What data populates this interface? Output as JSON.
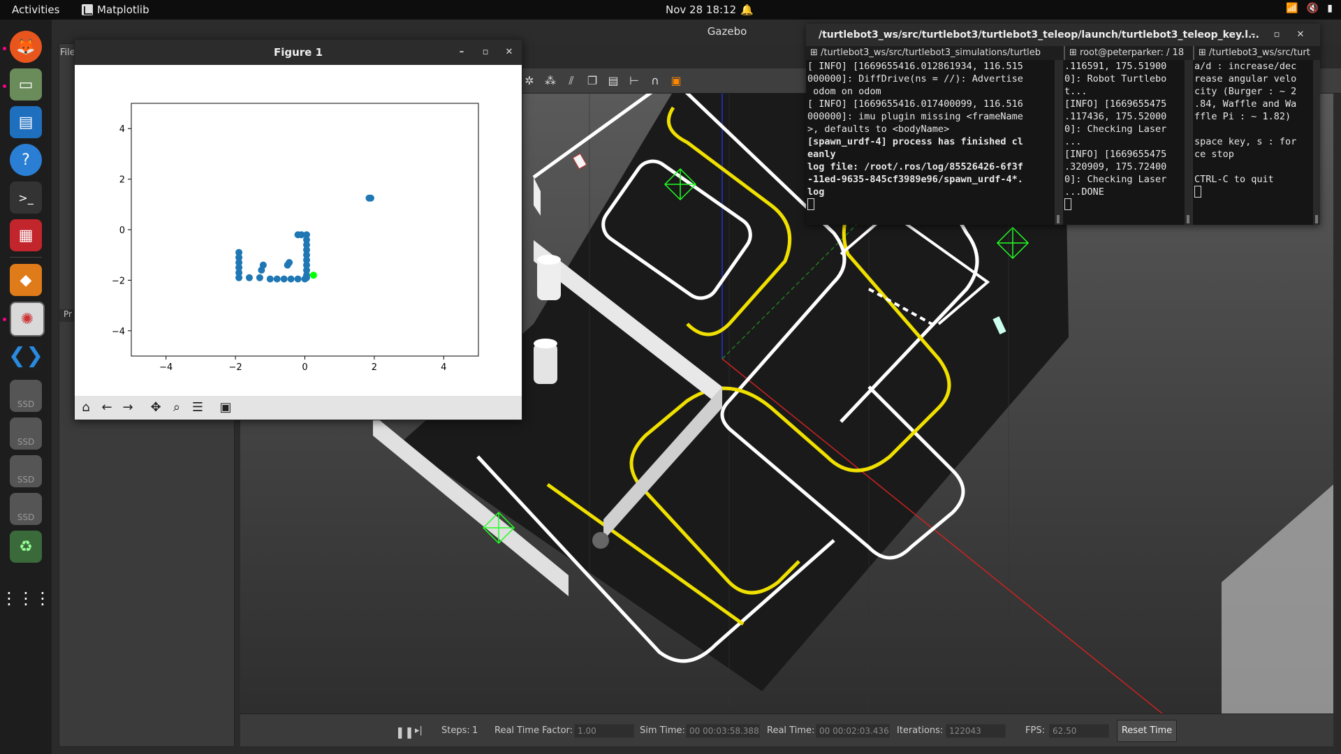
{
  "topbar": {
    "activities": "Activities",
    "app_name": "Matplotlib",
    "date_time": "Nov 28  18:12"
  },
  "dock": {
    "icons": [
      "firefox-icon",
      "files-icon",
      "writer-icon",
      "help-icon",
      "terminal-icon",
      "app-icon",
      "sublime-icon",
      "rqt-icon",
      "vscode-icon"
    ],
    "ssd_label": "SSD"
  },
  "gazebo": {
    "title": "Gazebo",
    "menu_file": "File",
    "left_panel_label": "Pr",
    "bottom": {
      "steps_label": "Steps:",
      "steps_value": "1",
      "rtf_label": "Real Time Factor:",
      "rtf_value": "1.00",
      "sim_time_label": "Sim Time:",
      "sim_time_value": "00 00:03:58.388",
      "real_time_label": "Real Time:",
      "real_time_value": "00 00:02:03.436",
      "iterations_label": "Iterations:",
      "iterations_value": "122043",
      "fps_label": "FPS:",
      "fps_value": "62.50",
      "reset_label": "Reset Time"
    }
  },
  "figure": {
    "title": "Figure 1",
    "toolbar": [
      "home-icon",
      "back-icon",
      "forward-icon",
      "pan-icon",
      "zoom-icon",
      "configure-icon",
      "save-icon"
    ]
  },
  "chart_data": {
    "type": "scatter",
    "title": "",
    "xlabel": "",
    "ylabel": "",
    "xlim": [
      -5,
      5
    ],
    "ylim": [
      -5,
      5
    ],
    "xticks": [
      -4,
      -2,
      0,
      2,
      4
    ],
    "yticks": [
      4,
      2,
      0,
      -2,
      -4
    ],
    "xtick_labels": [
      "−4",
      "−2",
      "0",
      "2",
      "4"
    ],
    "ytick_labels": [
      "4",
      "2",
      "0",
      "−2",
      "−4"
    ],
    "grid": false,
    "series": [
      {
        "color": "#1f77b4",
        "points": [
          [
            1.85,
            1.25
          ],
          [
            1.9,
            1.25
          ],
          [
            -1.9,
            -0.9
          ],
          [
            -1.9,
            -1.1
          ],
          [
            -1.9,
            -1.3
          ],
          [
            -1.9,
            -1.5
          ],
          [
            -1.9,
            -1.7
          ],
          [
            -1.9,
            -1.9
          ],
          [
            -1.6,
            -1.9
          ],
          [
            -1.3,
            -1.9
          ],
          [
            -1.25,
            -1.6
          ],
          [
            -1.2,
            -1.4
          ],
          [
            -1.0,
            -1.95
          ],
          [
            -0.8,
            -1.95
          ],
          [
            -0.6,
            -1.95
          ],
          [
            -0.4,
            -1.95
          ],
          [
            -0.2,
            -1.95
          ],
          [
            0.0,
            -1.95
          ],
          [
            -0.5,
            -1.4
          ],
          [
            -0.45,
            -1.3
          ],
          [
            -0.2,
            -0.2
          ],
          [
            -0.1,
            -0.2
          ],
          [
            0.05,
            -0.2
          ],
          [
            0.05,
            -0.4
          ],
          [
            0.05,
            -0.6
          ],
          [
            0.05,
            -0.8
          ],
          [
            0.05,
            -1.0
          ],
          [
            0.05,
            -1.2
          ],
          [
            0.05,
            -1.4
          ],
          [
            0.05,
            -1.6
          ],
          [
            0.05,
            -1.8
          ],
          [
            0.05,
            -1.9
          ]
        ]
      },
      {
        "color": "#00ff00",
        "points": [
          [
            0.25,
            -1.8
          ]
        ]
      }
    ]
  },
  "terminal": {
    "title": "/turtlebot3_ws/src/turtlebot3/turtlebot3_teleop/launch/turtlebot3_teleop_key.l...",
    "tabs": [
      "/turtlebot3_ws/src/turtlebot3_simulations/turtleb",
      "root@peterparker: / 18",
      "/turtlebot3_ws/src/turt"
    ],
    "pane1": [
      "[ INFO] [1669655416.012861934, 116.515",
      "000000]: DiffDrive(ns = //): Advertise",
      " odom on odom",
      "[ INFO] [1669655416.017400099, 116.516",
      "000000]: imu plugin missing <frameName",
      ">, defaults to <bodyName>",
      "[spawn_urdf-4] process has finished cl",
      "eanly",
      "log file: /root/.ros/log/85526426-6f3f",
      "-11ed-9635-845cf3989e96/spawn_urdf-4*.",
      "log"
    ],
    "pane2": [
      ".116591, 175.51900",
      "0]: Robot Turtlebo",
      "t...",
      "[INFO] [1669655475",
      ".117436, 175.52000",
      "0]: Checking Laser",
      "...",
      "[INFO] [1669655475",
      ".320909, 175.72400",
      "0]: Checking Laser",
      "...DONE"
    ],
    "pane3": [
      "a/d : increase/dec",
      "rease angular velo",
      "city (Burger : ~ 2",
      ".84, Waffle and Wa",
      "ffle Pi : ~ 1.82)",
      "",
      "space key, s : for",
      "ce stop",
      "",
      "CTRL-C to quit"
    ]
  }
}
